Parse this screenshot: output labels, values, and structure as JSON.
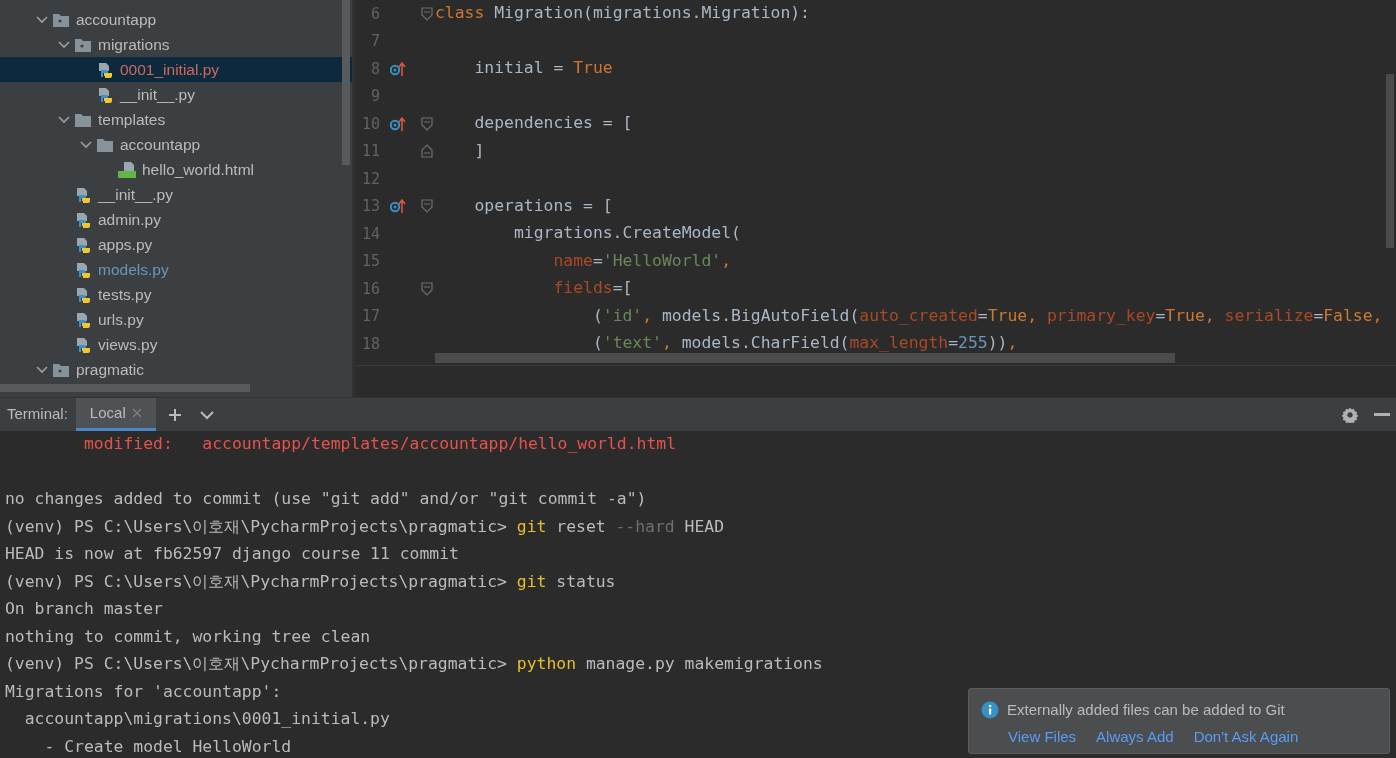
{
  "tree": {
    "items": [
      {
        "label": "accountapp",
        "kind": "module_folder",
        "expanded": true,
        "selected": false,
        "color": "#bbbbbb",
        "children": [
          {
            "label": "migrations",
            "kind": "module_folder",
            "expanded": true,
            "selected": false,
            "color": "#bbbbbb",
            "children": [
              {
                "label": "0001_initial.py",
                "kind": "python",
                "selected": true,
                "color": "#d1675a"
              },
              {
                "label": "__init__.py",
                "kind": "python",
                "selected": false,
                "color": "#bbbbbb"
              }
            ]
          },
          {
            "label": "templates",
            "kind": "folder",
            "expanded": true,
            "selected": false,
            "color": "#bbbbbb",
            "children": [
              {
                "label": "accountapp",
                "kind": "folder",
                "expanded": true,
                "selected": false,
                "color": "#bbbbbb",
                "children": [
                  {
                    "label": "hello_world.html",
                    "kind": "html",
                    "selected": false,
                    "color": "#bbbbbb"
                  }
                ]
              }
            ]
          },
          {
            "label": "__init__.py",
            "kind": "python",
            "selected": false,
            "color": "#bbbbbb"
          },
          {
            "label": "admin.py",
            "kind": "python",
            "selected": false,
            "color": "#bbbbbb"
          },
          {
            "label": "apps.py",
            "kind": "python",
            "selected": false,
            "color": "#bbbbbb"
          },
          {
            "label": "models.py",
            "kind": "python",
            "selected": false,
            "color": "#6897bb"
          },
          {
            "label": "tests.py",
            "kind": "python",
            "selected": false,
            "color": "#bbbbbb"
          },
          {
            "label": "urls.py",
            "kind": "python",
            "selected": false,
            "color": "#bbbbbb"
          },
          {
            "label": "views.py",
            "kind": "python",
            "selected": false,
            "color": "#bbbbbb"
          }
        ]
      },
      {
        "label": "pragmatic",
        "kind": "module_folder",
        "expanded": true,
        "selected": false,
        "color": "#bbbbbb"
      }
    ]
  },
  "editor": {
    "lines": [
      {
        "number": "6",
        "override": false,
        "fold_start": true,
        "fold_end": false,
        "tokens": [
          {
            "text": "class",
            "kind": "keyword"
          },
          {
            "text": " Migration(migrations.Migration):",
            "kind": "plain"
          }
        ]
      },
      {
        "number": "7",
        "override": false,
        "fold_start": false,
        "fold_end": false
      },
      {
        "number": "8",
        "override": true,
        "fold_start": false,
        "fold_end": false,
        "tokens": [
          {
            "text": "    initial = ",
            "kind": "plain"
          },
          {
            "text": "True",
            "kind": "keyword"
          }
        ]
      },
      {
        "number": "9",
        "override": false,
        "fold_start": false,
        "fold_end": false
      },
      {
        "number": "10",
        "override": true,
        "fold_start": true,
        "fold_end": false,
        "tokens": [
          {
            "text": "    dependencies = [",
            "kind": "plain"
          }
        ]
      },
      {
        "number": "11",
        "override": false,
        "fold_start": false,
        "fold_end": true,
        "tokens": [
          {
            "text": "    ]",
            "kind": "plain"
          }
        ]
      },
      {
        "number": "12",
        "override": false,
        "fold_start": false,
        "fold_end": false
      },
      {
        "number": "13",
        "override": true,
        "fold_start": true,
        "fold_end": false,
        "tokens": [
          {
            "text": "    operations = [",
            "kind": "plain"
          }
        ]
      },
      {
        "number": "14",
        "override": false,
        "fold_start": false,
        "fold_end": false,
        "tokens": [
          {
            "text": "        migrations.CreateModel(",
            "kind": "plain"
          }
        ]
      },
      {
        "number": "15",
        "override": false,
        "fold_start": false,
        "fold_end": false,
        "tokens": [
          {
            "text": "            name",
            "kind": "param"
          },
          {
            "text": "=",
            "kind": "plain"
          },
          {
            "text": "'HelloWorld'",
            "kind": "string"
          },
          {
            "text": ",",
            "kind": "keyword"
          }
        ]
      },
      {
        "number": "16",
        "override": false,
        "fold_start": true,
        "fold_end": false,
        "tokens": [
          {
            "text": "            fields",
            "kind": "param"
          },
          {
            "text": "=[",
            "kind": "plain"
          }
        ]
      },
      {
        "number": "17",
        "override": false,
        "fold_start": false,
        "fold_end": false,
        "tokens": [
          {
            "text": "                (",
            "kind": "plain"
          },
          {
            "text": "'id'",
            "kind": "string"
          },
          {
            "text": ",",
            "kind": "keyword"
          },
          {
            "text": " models.BigAutoField(",
            "kind": "plain"
          },
          {
            "text": "auto_created",
            "kind": "param"
          },
          {
            "text": "=",
            "kind": "plain"
          },
          {
            "text": "True",
            "kind": "keyword"
          },
          {
            "text": ", ",
            "kind": "keyword"
          },
          {
            "text": "primary_key",
            "kind": "param"
          },
          {
            "text": "=",
            "kind": "plain"
          },
          {
            "text": "True",
            "kind": "keyword"
          },
          {
            "text": ", ",
            "kind": "keyword"
          },
          {
            "text": "serialize",
            "kind": "param"
          },
          {
            "text": "=",
            "kind": "plain"
          },
          {
            "text": "False",
            "kind": "keyword"
          },
          {
            "text": ",",
            "kind": "keyword"
          }
        ]
      },
      {
        "number": "18",
        "override": false,
        "fold_start": false,
        "fold_end": false,
        "tokens": [
          {
            "text": "                (",
            "kind": "plain"
          },
          {
            "text": "'text'",
            "kind": "string"
          },
          {
            "text": ",",
            "kind": "keyword"
          },
          {
            "text": " models.CharField(",
            "kind": "plain"
          },
          {
            "text": "max_length",
            "kind": "param"
          },
          {
            "text": "=",
            "kind": "plain"
          },
          {
            "text": "255",
            "kind": "number"
          },
          {
            "text": "))",
            "kind": "plain"
          },
          {
            "text": ",",
            "kind": "keyword"
          }
        ]
      }
    ]
  },
  "terminal": {
    "label": "Terminal:",
    "tabs": [
      {
        "label": "Local",
        "selected": true
      }
    ],
    "blocks": [
      {
        "lines": [
          {
            "segments": [
              {
                "text": "        modified:   accountapp/templates/accountapp/hello_world.html",
                "kind": "error"
              }
            ]
          }
        ]
      },
      {
        "lines": [
          {
            "segments": [
              {
                "text": "no changes added to commit (use \"git add\" and/or \"git commit -a\")",
                "kind": "plain"
              }
            ]
          },
          {
            "segments": [
              {
                "text": "(venv) PS C:\\Users\\이호재\\PycharmProjects\\pragmatic> ",
                "kind": "plain"
              },
              {
                "text": "git",
                "kind": "command"
              },
              {
                "text": " reset ",
                "kind": "plain"
              },
              {
                "text": "--hard",
                "kind": "dim"
              },
              {
                "text": " HEAD",
                "kind": "plain"
              }
            ]
          },
          {
            "segments": [
              {
                "text": "HEAD is now at fb62597 django course 11 commit",
                "kind": "plain"
              }
            ]
          },
          {
            "segments": [
              {
                "text": "(venv) PS C:\\Users\\이호재\\PycharmProjects\\pragmatic> ",
                "kind": "plain"
              },
              {
                "text": "git",
                "kind": "command"
              },
              {
                "text": " status",
                "kind": "plain"
              }
            ]
          },
          {
            "segments": [
              {
                "text": "On branch master",
                "kind": "plain"
              }
            ]
          },
          {
            "segments": [
              {
                "text": "nothing to commit, working tree clean",
                "kind": "plain"
              }
            ]
          },
          {
            "segments": [
              {
                "text": "(venv) PS C:\\Users\\이호재\\PycharmProjects\\pragmatic> ",
                "kind": "plain"
              },
              {
                "text": "python",
                "kind": "command"
              },
              {
                "text": " manage.py makemigrations",
                "kind": "plain"
              }
            ]
          },
          {
            "segments": [
              {
                "text": "Migrations for 'accountapp':",
                "kind": "plain"
              }
            ]
          },
          {
            "segments": [
              {
                "text": "  accountapp\\migrations\\0001_initial.py",
                "kind": "plain"
              }
            ]
          },
          {
            "segments": [
              {
                "text": "    - Create model HelloWorld",
                "kind": "plain"
              }
            ]
          }
        ]
      }
    ]
  },
  "notification": {
    "message": "Externally added files can be added to Git",
    "actions": [
      "View Files",
      "Always Add",
      "Don't Ask Again"
    ]
  }
}
